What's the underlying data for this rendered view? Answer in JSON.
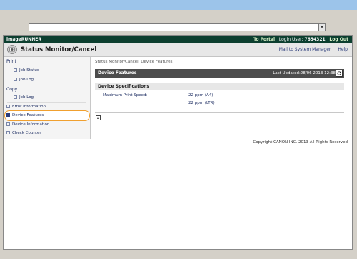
{
  "browser": {
    "address_value": "",
    "dropdown_glyph": "▾"
  },
  "topbar": {
    "brand": "imageRUNNER",
    "to_portal": "To Portal",
    "login_label": "Login User:",
    "login_user": "7654321",
    "logout": "Log Out"
  },
  "header": {
    "title": "Status Monitor/Cancel",
    "mail_link": "Mail to System Manager",
    "help_link": "Help"
  },
  "sidebar": {
    "print_heading": "Print",
    "print_items": [
      "Job Status",
      "Job Log"
    ],
    "copy_heading": "Copy",
    "copy_items": [
      "Job Log"
    ],
    "other_items": [
      "Error Information",
      "Device Features",
      "Device Information",
      "Check Counter"
    ],
    "active": "Device Features"
  },
  "main": {
    "breadcrumb": "Status Monitor/Cancel: Device Features",
    "section_title": "Device Features",
    "last_updated": "Last Updated:28/06 2013 12:38",
    "spec_title": "Device Specifications",
    "spec_label": "Maximum Print Speed:",
    "spec_values": [
      "22 ppm (A4)",
      "22 ppm (LTR)"
    ]
  },
  "footer": {
    "copyright": "Copyright CANON INC. 2013 All Rights Reserved"
  },
  "colors": {
    "topbar": "#0c3f2f",
    "link": "#2b3c7a",
    "highlight": "#f0a030",
    "section_bar": "#4c4c4c"
  }
}
